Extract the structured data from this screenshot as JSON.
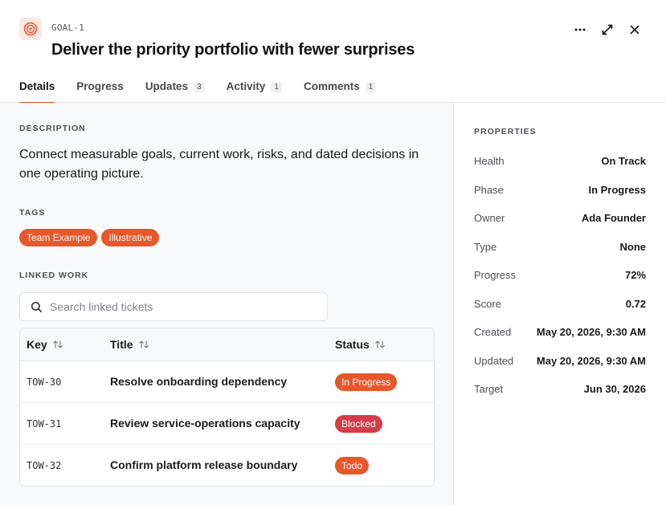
{
  "header": {
    "goal_key": "GOAL-1",
    "goal_title": "Deliver the priority portfolio with fewer surprises",
    "icon": "target-icon",
    "actions": [
      "more-icon",
      "expand-icon",
      "close-icon"
    ]
  },
  "tabs": [
    {
      "label": "Details",
      "count": null,
      "active": true
    },
    {
      "label": "Progress",
      "count": null,
      "active": false
    },
    {
      "label": "Updates",
      "count": "3",
      "active": false
    },
    {
      "label": "Activity",
      "count": "1",
      "active": false
    },
    {
      "label": "Comments",
      "count": "1",
      "active": false
    }
  ],
  "description": {
    "label": "DESCRIPTION",
    "text": "Connect measurable goals, current work, risks, and dated decisions in one operating picture."
  },
  "tags": {
    "label": "TAGS",
    "items": [
      "Team Example",
      "Illustrative"
    ]
  },
  "linked_work": {
    "label": "LINKED WORK",
    "search_placeholder": "Search linked tickets",
    "columns": [
      "Key",
      "Title",
      "Status"
    ],
    "rows": [
      {
        "key": "TOW-30",
        "title": "Resolve onboarding dependency",
        "status": "In Progress",
        "status_color": "#e8572b"
      },
      {
        "key": "TOW-31",
        "title": "Review service-operations capacity",
        "status": "Blocked",
        "status_color": "#d63c4a"
      },
      {
        "key": "TOW-32",
        "title": "Confirm platform release boundary",
        "status": "Todo",
        "status_color": "#e8572b"
      }
    ]
  },
  "properties": {
    "label": "PROPERTIES",
    "items": [
      {
        "label": "Health",
        "value": "On Track"
      },
      {
        "label": "Phase",
        "value": "In Progress"
      },
      {
        "label": "Owner",
        "value": "Ada Founder"
      },
      {
        "label": "Type",
        "value": "None"
      },
      {
        "label": "Progress",
        "value": "72%"
      },
      {
        "label": "Score",
        "value": "0.72"
      },
      {
        "label": "Created",
        "value": "May 20, 2026, 9:30 AM"
      },
      {
        "label": "Updated",
        "value": "May 20, 2026, 9:30 AM"
      },
      {
        "label": "Target",
        "value": "Jun 30, 2026"
      }
    ]
  },
  "colors": {
    "accent": "#e0552a",
    "tag": "#e8572b",
    "blocked": "#d63c4a"
  }
}
